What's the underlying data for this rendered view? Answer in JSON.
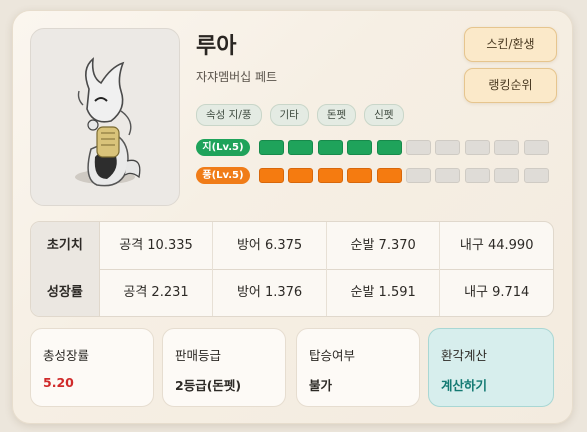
{
  "pet": {
    "name": "루아",
    "type": "자쟈멤버십 페트",
    "tags": [
      "속성 지/풍",
      "기타",
      "돈펫",
      "신펫"
    ],
    "attributes": [
      {
        "label": "지(Lv.5)",
        "level": 5,
        "max": 10,
        "color": "#1fa35b"
      },
      {
        "label": "풍(Lv.5)",
        "level": 5,
        "max": 10,
        "color": "#f57b10"
      }
    ]
  },
  "buttons": {
    "skin": "스킨/환생",
    "ranking": "랭킹순위"
  },
  "stats": {
    "initial": {
      "label": "초기치",
      "cells": [
        "공격 10.335",
        "방어 6.375",
        "순발 7.370",
        "내구 44.990"
      ]
    },
    "growth": {
      "label": "성장률",
      "cells": [
        "공격 2.231",
        "방어 1.376",
        "순발 1.591",
        "내구 9.714"
      ]
    }
  },
  "info": {
    "total_growth": {
      "label": "총성장률",
      "value": "5.20"
    },
    "sale_grade": {
      "label": "판매등급",
      "value": "2등급(돈펫)"
    },
    "rideable": {
      "label": "탑승여부",
      "value": "불가"
    },
    "calc": {
      "label": "환각계산",
      "value": "계산하기"
    }
  },
  "colors": {
    "earth": "#1fa35b",
    "wind": "#f57b10",
    "growth_value": "#d02a2a",
    "calc_accent": "#147a73"
  }
}
